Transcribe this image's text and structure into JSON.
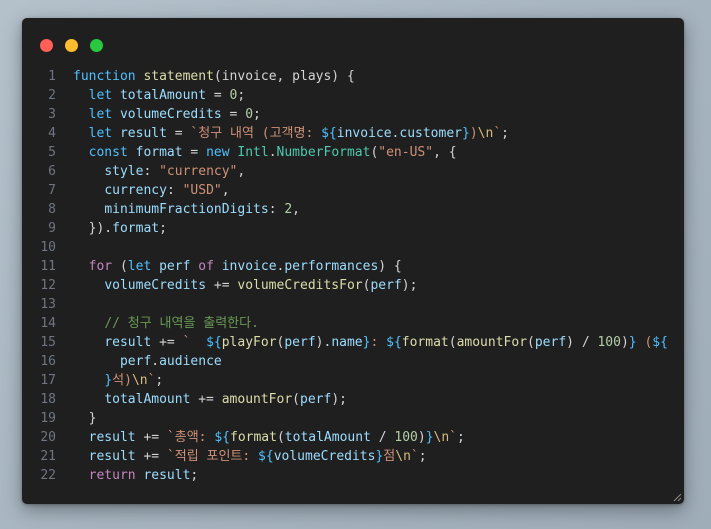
{
  "window": {
    "buttons": [
      {
        "name": "close-button",
        "color": "#ff5f57"
      },
      {
        "name": "minimize-button",
        "color": "#febc2e"
      },
      {
        "name": "maximize-button",
        "color": "#28c840"
      }
    ]
  },
  "palette": {
    "keyword": "#4fc1ff",
    "control": "#c586c0",
    "function": "#dcdcaa",
    "variable": "#9cdcfe",
    "class": "#4ec9b0",
    "string": "#ce9178",
    "number": "#b5cea8",
    "comment": "#6a9955",
    "escape": "#d7ba7d",
    "punct": "#d4d4d4"
  },
  "code_lines": [
    {
      "n": "1",
      "tokens": [
        [
          "keyword",
          "function"
        ],
        [
          "punct",
          " "
        ],
        [
          "function",
          "statement"
        ],
        [
          "punct",
          "(invoice, plays) {"
        ]
      ]
    },
    {
      "n": "2",
      "tokens": [
        [
          "punct",
          "  "
        ],
        [
          "keyword",
          "let"
        ],
        [
          "punct",
          " "
        ],
        [
          "variable",
          "totalAmount"
        ],
        [
          "punct",
          " = "
        ],
        [
          "number",
          "0"
        ],
        [
          "punct",
          ";"
        ]
      ]
    },
    {
      "n": "3",
      "tokens": [
        [
          "punct",
          "  "
        ],
        [
          "keyword",
          "let"
        ],
        [
          "punct",
          " "
        ],
        [
          "variable",
          "volumeCredits"
        ],
        [
          "punct",
          " = "
        ],
        [
          "number",
          "0"
        ],
        [
          "punct",
          ";"
        ]
      ]
    },
    {
      "n": "4",
      "tokens": [
        [
          "punct",
          "  "
        ],
        [
          "keyword",
          "let"
        ],
        [
          "punct",
          " "
        ],
        [
          "variable",
          "result"
        ],
        [
          "punct",
          " = "
        ],
        [
          "string",
          "`청구 내역 (고객명: "
        ],
        [
          "keyword",
          "${"
        ],
        [
          "variable",
          "invoice.customer"
        ],
        [
          "keyword",
          "}"
        ],
        [
          "string",
          ")"
        ],
        [
          "escape",
          "\\n"
        ],
        [
          "string",
          "`"
        ],
        [
          "punct",
          ";"
        ]
      ]
    },
    {
      "n": "5",
      "tokens": [
        [
          "punct",
          "  "
        ],
        [
          "keyword",
          "const"
        ],
        [
          "punct",
          " "
        ],
        [
          "variable",
          "format"
        ],
        [
          "punct",
          " = "
        ],
        [
          "keyword",
          "new"
        ],
        [
          "punct",
          " "
        ],
        [
          "class",
          "Intl"
        ],
        [
          "punct",
          "."
        ],
        [
          "class",
          "NumberFormat"
        ],
        [
          "punct",
          "("
        ],
        [
          "string",
          "\"en-US\""
        ],
        [
          "punct",
          ", {"
        ]
      ]
    },
    {
      "n": "6",
      "tokens": [
        [
          "punct",
          "    "
        ],
        [
          "variable",
          "style"
        ],
        [
          "punct",
          ": "
        ],
        [
          "string",
          "\"currency\""
        ],
        [
          "punct",
          ","
        ]
      ]
    },
    {
      "n": "7",
      "tokens": [
        [
          "punct",
          "    "
        ],
        [
          "variable",
          "currency"
        ],
        [
          "punct",
          ": "
        ],
        [
          "string",
          "\"USD\""
        ],
        [
          "punct",
          ","
        ]
      ]
    },
    {
      "n": "8",
      "tokens": [
        [
          "punct",
          "    "
        ],
        [
          "variable",
          "minimumFractionDigits"
        ],
        [
          "punct",
          ": "
        ],
        [
          "number",
          "2"
        ],
        [
          "punct",
          ","
        ]
      ]
    },
    {
      "n": "9",
      "tokens": [
        [
          "punct",
          "  })."
        ],
        [
          "variable",
          "format"
        ],
        [
          "punct",
          ";"
        ]
      ]
    },
    {
      "n": "10",
      "tokens": []
    },
    {
      "n": "11",
      "tokens": [
        [
          "punct",
          "  "
        ],
        [
          "control",
          "for"
        ],
        [
          "punct",
          " ("
        ],
        [
          "keyword",
          "let"
        ],
        [
          "punct",
          " "
        ],
        [
          "variable",
          "perf"
        ],
        [
          "punct",
          " "
        ],
        [
          "control",
          "of"
        ],
        [
          "punct",
          " "
        ],
        [
          "variable",
          "invoice"
        ],
        [
          "punct",
          "."
        ],
        [
          "variable",
          "performances"
        ],
        [
          "punct",
          ") {"
        ]
      ]
    },
    {
      "n": "12",
      "tokens": [
        [
          "punct",
          "    "
        ],
        [
          "variable",
          "volumeCredits"
        ],
        [
          "punct",
          " += "
        ],
        [
          "function",
          "volumeCreditsFor"
        ],
        [
          "punct",
          "("
        ],
        [
          "variable",
          "perf"
        ],
        [
          "punct",
          ");"
        ]
      ]
    },
    {
      "n": "13",
      "tokens": []
    },
    {
      "n": "14",
      "tokens": [
        [
          "punct",
          "    "
        ],
        [
          "comment",
          "// 청구 내역을 출력한다."
        ]
      ]
    },
    {
      "n": "15",
      "tokens": [
        [
          "punct",
          "    "
        ],
        [
          "variable",
          "result"
        ],
        [
          "punct",
          " += "
        ],
        [
          "string",
          "`  "
        ],
        [
          "keyword",
          "${"
        ],
        [
          "function",
          "playFor"
        ],
        [
          "punct",
          "("
        ],
        [
          "variable",
          "perf"
        ],
        [
          "punct",
          ")."
        ],
        [
          "variable",
          "name"
        ],
        [
          "keyword",
          "}"
        ],
        [
          "string",
          ": "
        ],
        [
          "keyword",
          "${"
        ],
        [
          "function",
          "format"
        ],
        [
          "punct",
          "("
        ],
        [
          "function",
          "amountFor"
        ],
        [
          "punct",
          "("
        ],
        [
          "variable",
          "perf"
        ],
        [
          "punct",
          ") / "
        ],
        [
          "number",
          "100"
        ],
        [
          "punct",
          ")"
        ],
        [
          "keyword",
          "}"
        ],
        [
          "string",
          " ("
        ],
        [
          "keyword",
          "${"
        ]
      ]
    },
    {
      "n": "16",
      "tokens": [
        [
          "punct",
          "      "
        ],
        [
          "variable",
          "perf"
        ],
        [
          "punct",
          "."
        ],
        [
          "variable",
          "audience"
        ]
      ]
    },
    {
      "n": "17",
      "tokens": [
        [
          "punct",
          "    "
        ],
        [
          "keyword",
          "}"
        ],
        [
          "string",
          "석)"
        ],
        [
          "escape",
          "\\n"
        ],
        [
          "string",
          "`"
        ],
        [
          "punct",
          ";"
        ]
      ]
    },
    {
      "n": "18",
      "tokens": [
        [
          "punct",
          "    "
        ],
        [
          "variable",
          "totalAmount"
        ],
        [
          "punct",
          " += "
        ],
        [
          "function",
          "amountFor"
        ],
        [
          "punct",
          "("
        ],
        [
          "variable",
          "perf"
        ],
        [
          "punct",
          ");"
        ]
      ]
    },
    {
      "n": "19",
      "tokens": [
        [
          "punct",
          "  }"
        ]
      ]
    },
    {
      "n": "20",
      "tokens": [
        [
          "punct",
          "  "
        ],
        [
          "variable",
          "result"
        ],
        [
          "punct",
          " += "
        ],
        [
          "string",
          "`총액: "
        ],
        [
          "keyword",
          "${"
        ],
        [
          "function",
          "format"
        ],
        [
          "punct",
          "("
        ],
        [
          "variable",
          "totalAmount"
        ],
        [
          "punct",
          " / "
        ],
        [
          "number",
          "100"
        ],
        [
          "punct",
          ")"
        ],
        [
          "keyword",
          "}"
        ],
        [
          "escape",
          "\\n"
        ],
        [
          "string",
          "`"
        ],
        [
          "punct",
          ";"
        ]
      ]
    },
    {
      "n": "21",
      "tokens": [
        [
          "punct",
          "  "
        ],
        [
          "variable",
          "result"
        ],
        [
          "punct",
          " += "
        ],
        [
          "string",
          "`적립 포인트: "
        ],
        [
          "keyword",
          "${"
        ],
        [
          "variable",
          "volumeCredits"
        ],
        [
          "keyword",
          "}"
        ],
        [
          "string",
          "점"
        ],
        [
          "escape",
          "\\n"
        ],
        [
          "string",
          "`"
        ],
        [
          "punct",
          ";"
        ]
      ]
    },
    {
      "n": "22",
      "tokens": [
        [
          "punct",
          "  "
        ],
        [
          "control",
          "return"
        ],
        [
          "punct",
          " "
        ],
        [
          "variable",
          "result"
        ],
        [
          "punct",
          ";"
        ]
      ]
    }
  ]
}
